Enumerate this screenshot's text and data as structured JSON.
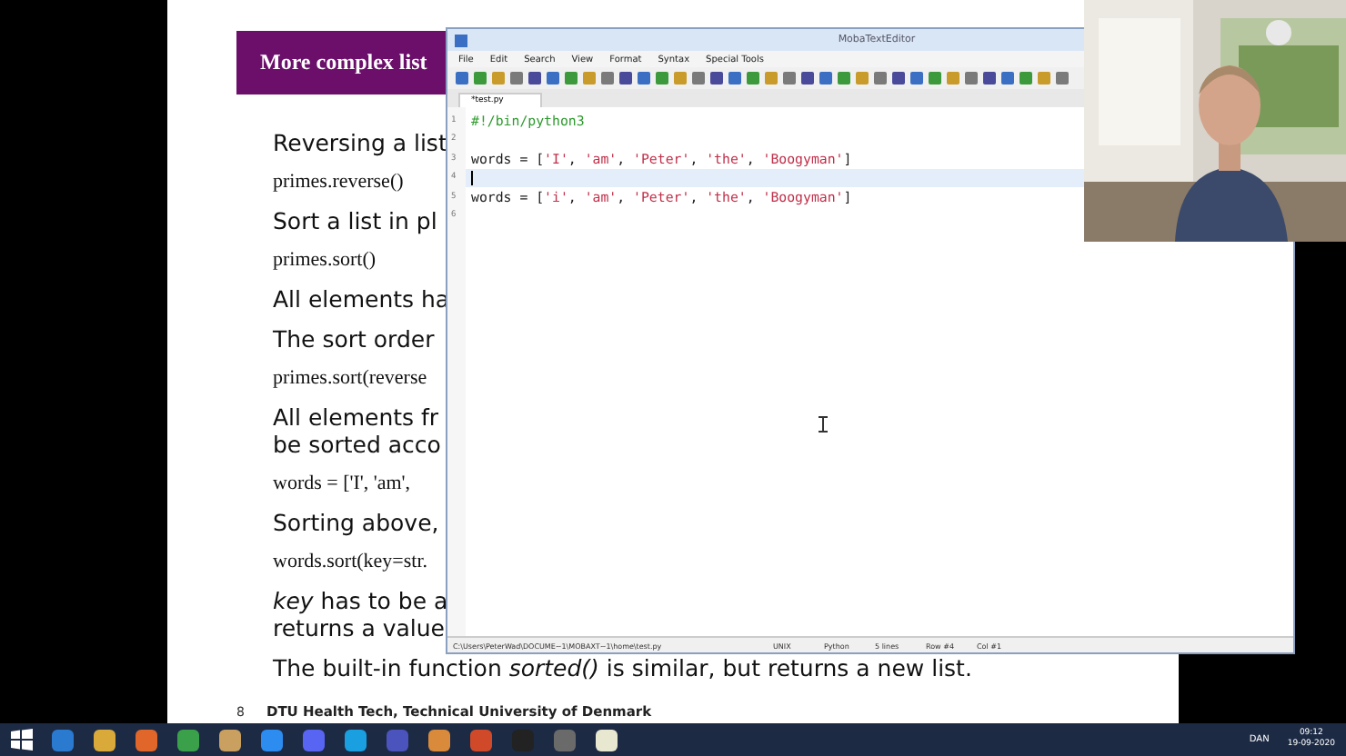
{
  "slide": {
    "title": "More complex list",
    "items": [
      {
        "kind": "text",
        "lines": [
          "Reversing a list"
        ]
      },
      {
        "kind": "code",
        "lines": [
          "primes.reverse()"
        ]
      },
      {
        "kind": "text",
        "lines": [
          "Sort a list in pl"
        ]
      },
      {
        "kind": "code",
        "lines": [
          "primes.sort()"
        ]
      },
      {
        "kind": "text",
        "lines": [
          "All elements ha"
        ]
      },
      {
        "kind": "text",
        "lines": [
          "The sort order"
        ]
      },
      {
        "kind": "code",
        "lines": [
          "primes.sort(reverse"
        ]
      },
      {
        "kind": "text",
        "lines": [
          "All elements fr",
          "be sorted acco"
        ]
      },
      {
        "kind": "code",
        "lines": [
          "words = ['I', 'am',"
        ]
      },
      {
        "kind": "text",
        "lines": [
          "Sorting above,"
        ]
      },
      {
        "kind": "code",
        "lines": [
          "words.sort(key=str."
        ]
      },
      {
        "kind": "text",
        "lines": [
          "*key* has to be a",
          "returns a value"
        ]
      },
      {
        "kind": "text",
        "lines": [
          "The built-in function *sorted()* is similar, but returns a new list."
        ]
      }
    ],
    "page_number": "8",
    "footer": "DTU Health Tech, Technical University of Denmark"
  },
  "editor": {
    "title": "MobaTextEditor",
    "menu": [
      "File",
      "Edit",
      "Search",
      "View",
      "Format",
      "Syntax",
      "Special Tools"
    ],
    "tabs": [
      {
        "label": "*test.py",
        "selected": true
      }
    ],
    "lines": [
      {
        "number": "1",
        "current": false,
        "tokens": [
          {
            "kind": "comment",
            "text": "#!/bin/python3"
          }
        ]
      },
      {
        "number": "2",
        "current": false
      },
      {
        "number": "3",
        "current": false,
        "tokens": [
          {
            "kind": "plain",
            "text": "words = ["
          },
          {
            "kind": "string",
            "text": "'I'"
          },
          {
            "kind": "plain",
            "text": ", "
          },
          {
            "kind": "string",
            "text": "'am'"
          },
          {
            "kind": "plain",
            "text": ", "
          },
          {
            "kind": "string",
            "text": "'Peter'"
          },
          {
            "kind": "plain",
            "text": ", "
          },
          {
            "kind": "string",
            "text": "'the'"
          },
          {
            "kind": "plain",
            "text": ", "
          },
          {
            "kind": "string",
            "text": "'Boogyman'"
          },
          {
            "kind": "plain",
            "text": "]"
          }
        ]
      },
      {
        "number": "4",
        "current": true
      },
      {
        "number": "5",
        "current": false,
        "tokens": [
          {
            "kind": "plain",
            "text": "words = ["
          },
          {
            "kind": "string",
            "text": "'i'"
          },
          {
            "kind": "plain",
            "text": ", "
          },
          {
            "kind": "string",
            "text": "'am'"
          },
          {
            "kind": "plain",
            "text": ", "
          },
          {
            "kind": "string",
            "text": "'Peter'"
          },
          {
            "kind": "plain",
            "text": ", "
          },
          {
            "kind": "string",
            "text": "'the'"
          },
          {
            "kind": "plain",
            "text": ", "
          },
          {
            "kind": "string",
            "text": "'Boogyman'"
          },
          {
            "kind": "plain",
            "text": "]"
          }
        ]
      },
      {
        "number": "6",
        "current": false
      }
    ],
    "status": [
      "C:\\Users\\PeterWad\\DOCUME~1\\MOBAXT~1\\home\\test.py",
      "UNIX",
      "Python",
      "5 lines",
      "Row #4",
      "Col #1"
    ]
  },
  "taskbar": {
    "language": "DAN",
    "time": "09:12",
    "date": "19-09-2020"
  }
}
